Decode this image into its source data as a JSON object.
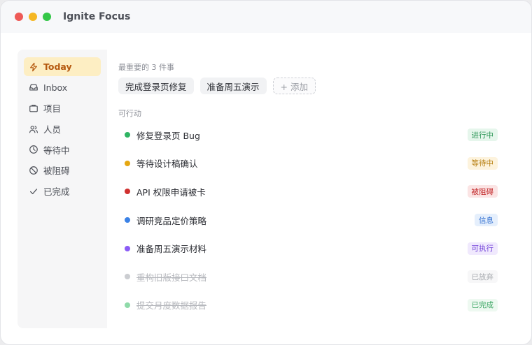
{
  "window": {
    "title": "Ignite Focus"
  },
  "sidebar": {
    "items": [
      {
        "label": "Today",
        "icon": "bolt-icon",
        "active": true
      },
      {
        "label": "Inbox",
        "icon": "inbox-icon"
      },
      {
        "label": "项目",
        "icon": "briefcase-icon"
      },
      {
        "label": "人员",
        "icon": "people-icon"
      },
      {
        "label": "等待中",
        "icon": "clock-icon"
      },
      {
        "label": "被阻碍",
        "icon": "blocked-icon"
      },
      {
        "label": "已完成",
        "icon": "check-icon"
      }
    ]
  },
  "main": {
    "top3_label": "最重要的 3 件事",
    "top3": [
      "完成登录页修复",
      "准备周五演示"
    ],
    "add_label": "+ 添加",
    "actions_label": "可行动",
    "tasks": [
      {
        "title": "修复登录页 Bug",
        "status": "进行中",
        "dot": "#2fb463",
        "badge_bg": "#e6f6ec",
        "badge_fg": "#23914f"
      },
      {
        "title": "等待设计稿确认",
        "status": "等待中",
        "dot": "#e5a711",
        "badge_bg": "#fdf3dd",
        "badge_fg": "#b47a08"
      },
      {
        "title": "API 权限申请被卡",
        "status": "被阻碍",
        "dot": "#d0302f",
        "badge_bg": "#fbe4e4",
        "badge_fg": "#c2282a"
      },
      {
        "title": "调研竞品定价策略",
        "status": "信息",
        "dot": "#3b82e6",
        "badge_bg": "#e5effc",
        "badge_fg": "#2f6ed0"
      },
      {
        "title": "准备周五演示材料",
        "status": "可执行",
        "dot": "#8b5cf6",
        "badge_bg": "#f0e9fd",
        "badge_fg": "#7444d9"
      },
      {
        "title": "重构旧版接口文档",
        "status": "已放弃",
        "dot": "#cbcdd1",
        "badge_bg": "#f7f7f8",
        "badge_fg": "#a6a9ae",
        "done": true
      },
      {
        "title": "提交月度数据报告",
        "status": "已完成",
        "dot": "#8fdaa9",
        "badge_bg": "#eef9f1",
        "badge_fg": "#3aa562",
        "done": true
      }
    ]
  }
}
